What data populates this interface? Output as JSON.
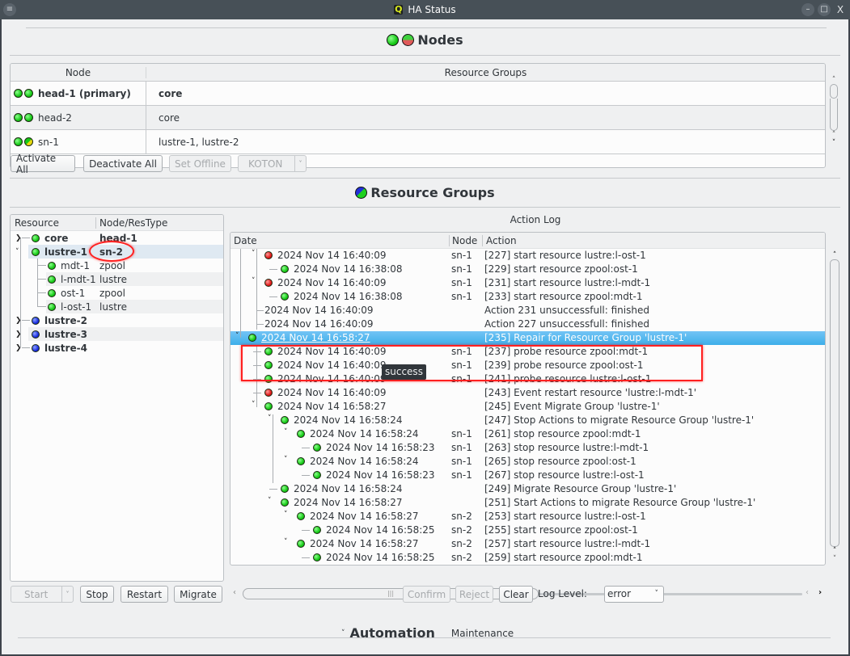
{
  "window": {
    "title": "HA Status",
    "app_icon": "Q",
    "controls": [
      "minimize",
      "maximize",
      "close"
    ]
  },
  "nodes_section": {
    "title": "Nodes",
    "columns": [
      "Node",
      "Resource Groups"
    ],
    "rows": [
      {
        "name": "head-1 (primary)",
        "resource_groups": "core",
        "status": [
          "green",
          "green"
        ],
        "bold": true
      },
      {
        "name": "head-2",
        "resource_groups": "core",
        "status": [
          "green",
          "green"
        ],
        "bold": false
      },
      {
        "name": "sn-1",
        "resource_groups": "lustre-1, lustre-2",
        "status": [
          "green",
          "green-yellow"
        ],
        "bold": false
      }
    ],
    "buttons": {
      "activate_all": "Activate All",
      "deactivate_all": "Deactivate All",
      "set_offline": "Set Offline",
      "koton": "KOTON"
    }
  },
  "resource_groups_section": {
    "title": "Resource Groups",
    "tree_columns": [
      "Resource",
      "Node/ResType"
    ],
    "tree": [
      {
        "name": "core",
        "value": "head-1",
        "status": "green",
        "level": 0,
        "expanded": false,
        "bold": true
      },
      {
        "name": "lustre-1",
        "value": "sn-2",
        "status": "green",
        "level": 0,
        "expanded": true,
        "bold": true,
        "selected": true
      },
      {
        "name": "mdt-1",
        "value": "zpool",
        "status": "green",
        "level": 1
      },
      {
        "name": "l-mdt-1",
        "value": "lustre",
        "status": "green",
        "level": 1
      },
      {
        "name": "ost-1",
        "value": "zpool",
        "status": "green",
        "level": 1
      },
      {
        "name": "l-ost-1",
        "value": "lustre",
        "status": "green",
        "level": 1
      },
      {
        "name": "lustre-2",
        "value": "",
        "status": "blue",
        "level": 0,
        "expanded": false,
        "bold": true
      },
      {
        "name": "lustre-3",
        "value": "",
        "status": "blue",
        "level": 0,
        "expanded": false,
        "bold": true
      },
      {
        "name": "lustre-4",
        "value": "",
        "status": "blue",
        "level": 0,
        "expanded": false,
        "bold": true
      }
    ],
    "buttons": {
      "start": "Start",
      "stop": "Stop",
      "restart": "Restart",
      "migrate": "Migrate"
    }
  },
  "action_log": {
    "title": "Action Log",
    "columns": [
      "Date",
      "Node",
      "Action"
    ],
    "rows": [
      {
        "date": "2024 Nov 14 16:40:09",
        "node": "sn-1",
        "action": "[227] start resource lustre:l-ost-1",
        "status": "red",
        "level": 1,
        "expander": true
      },
      {
        "date": "2024 Nov 14 16:38:08",
        "node": "sn-1",
        "action": "[229] start resource zpool:ost-1",
        "status": "green",
        "level": 2
      },
      {
        "date": "2024 Nov 14 16:40:09",
        "node": "sn-1",
        "action": "[231] start resource lustre:l-mdt-1",
        "status": "red",
        "level": 1,
        "expander": true
      },
      {
        "date": "2024 Nov 14 16:38:08",
        "node": "sn-1",
        "action": "[233] start resource zpool:mdt-1",
        "status": "green",
        "level": 2
      },
      {
        "date": "2024 Nov 14 16:40:09",
        "node": "",
        "action": "Action 231 unsuccessfull: finished",
        "status": "",
        "level": 1
      },
      {
        "date": "2024 Nov 14 16:40:09",
        "node": "",
        "action": "Action 227 unsuccessfull: finished",
        "status": "",
        "level": 1
      },
      {
        "date": "2024 Nov 14 16:58:27",
        "node": "",
        "action": "[235] Repair for Resource Group 'lustre-1'",
        "status": "green",
        "level": 0,
        "expander": true,
        "selected": true
      },
      {
        "date": "2024 Nov 14 16:40:09",
        "node": "sn-1",
        "action": "[237] probe resource zpool:mdt-1",
        "status": "green",
        "level": 1
      },
      {
        "date": "2024 Nov 14 16:40:09",
        "node": "sn-1",
        "action": "[239] probe resource zpool:ost-1",
        "status": "green",
        "level": 1
      },
      {
        "date": "2024 Nov 14 16:40:09",
        "node": "sn-1",
        "action": "[241] probe resource lustre:l-ost-1",
        "status": "green",
        "level": 1
      },
      {
        "date": "2024 Nov 14 16:40:09",
        "node": "",
        "action": "[243] Event restart resource 'lustre:l-mdt-1'",
        "status": "red",
        "level": 1
      },
      {
        "date": "2024 Nov 14 16:58:27",
        "node": "",
        "action": "[245] Event Migrate Group 'lustre-1'",
        "status": "green",
        "level": 1,
        "expander": true
      },
      {
        "date": "2024 Nov 14 16:58:24",
        "node": "",
        "action": "[247] Stop Actions to migrate Resource Group 'lustre-1'",
        "status": "green",
        "level": 2,
        "expander": true
      },
      {
        "date": "2024 Nov 14 16:58:24",
        "node": "sn-1",
        "action": "[261] stop resource zpool:mdt-1",
        "status": "green",
        "level": 3,
        "expander": true
      },
      {
        "date": "2024 Nov 14 16:58:23",
        "node": "sn-1",
        "action": "[263] stop resource lustre:l-mdt-1",
        "status": "green",
        "level": 4
      },
      {
        "date": "2024 Nov 14 16:58:24",
        "node": "sn-1",
        "action": "[265] stop resource zpool:ost-1",
        "status": "green",
        "level": 3,
        "expander": true
      },
      {
        "date": "2024 Nov 14 16:58:23",
        "node": "sn-1",
        "action": "[267] stop resource lustre:l-ost-1",
        "status": "green",
        "level": 4
      },
      {
        "date": "2024 Nov 14 16:58:24",
        "node": "",
        "action": "[249] Migrate Resource Group 'lustre-1'",
        "status": "green",
        "level": 2
      },
      {
        "date": "2024 Nov 14 16:58:27",
        "node": "",
        "action": "[251] Start Actions to migrate Resource Group 'lustre-1'",
        "status": "green",
        "level": 2,
        "expander": true
      },
      {
        "date": "2024 Nov 14 16:58:27",
        "node": "sn-2",
        "action": "[253] start resource lustre:l-ost-1",
        "status": "green",
        "level": 3,
        "expander": true
      },
      {
        "date": "2024 Nov 14 16:58:25",
        "node": "sn-2",
        "action": "[255] start resource zpool:ost-1",
        "status": "green",
        "level": 4
      },
      {
        "date": "2024 Nov 14 16:58:27",
        "node": "sn-2",
        "action": "[257] start resource lustre:l-mdt-1",
        "status": "green",
        "level": 3,
        "expander": true
      },
      {
        "date": "2024 Nov 14 16:58:25",
        "node": "sn-2",
        "action": "[259] start resource zpool:mdt-1",
        "status": "green",
        "level": 4
      }
    ],
    "tooltip": "success",
    "buttons": {
      "confirm": "Confirm",
      "reject": "Reject",
      "clear": "Clear"
    },
    "log_level_label": "Log Level:",
    "log_level_value": "error"
  },
  "automation_section": {
    "title": "Automation",
    "status": "Maintenance"
  },
  "colors": {
    "selection": "#3daee9",
    "annotation": "#ff2020",
    "status_green": "#17c917",
    "status_red": "#e01a1a",
    "status_blue": "#1a2ee0"
  }
}
